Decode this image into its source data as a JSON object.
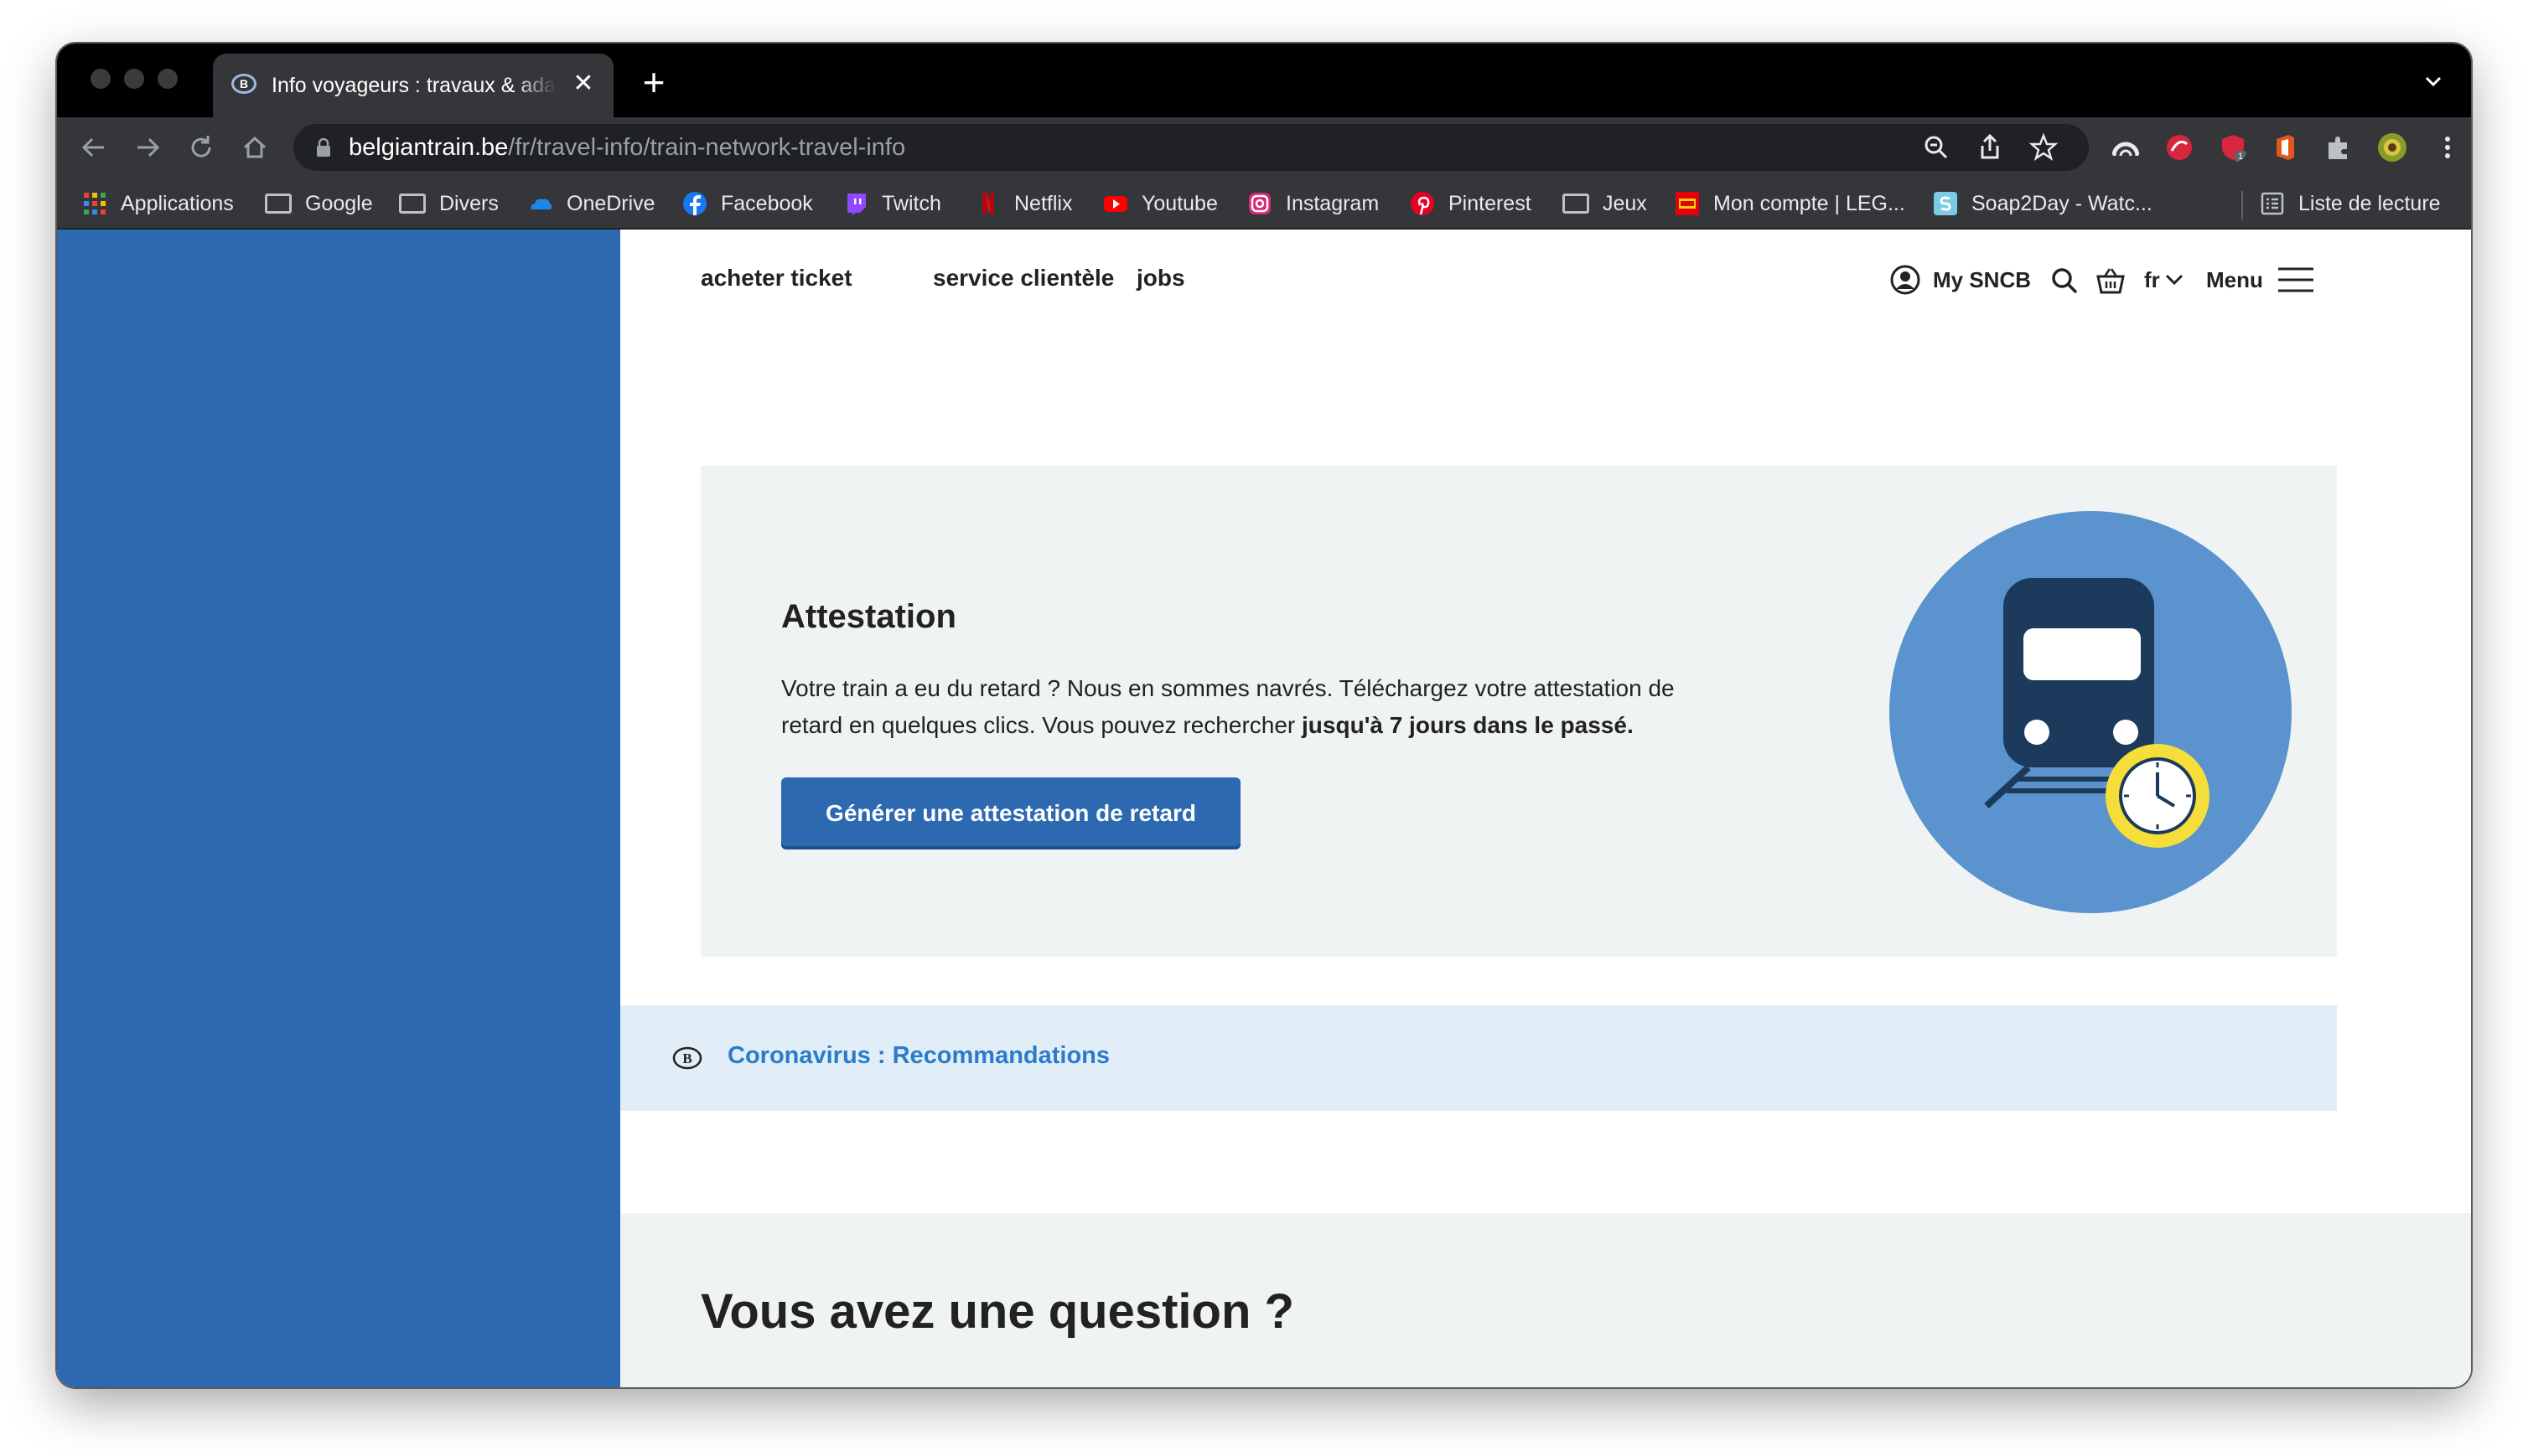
{
  "browser": {
    "tab_title": "Info voyageurs : travaux & adaptations",
    "tab_close": "✕",
    "new_tab": "+",
    "url_host": "belgiantrain.be",
    "url_path": "/fr/travel-info/train-network-travel-info",
    "extension_badge": "1"
  },
  "bookmarks": {
    "items": [
      {
        "label": "Applications",
        "icon": "apps-grid-icon"
      },
      {
        "label": "Google",
        "icon": "folder-icon"
      },
      {
        "label": "Divers",
        "icon": "folder-icon"
      },
      {
        "label": "OneDrive",
        "icon": "onedrive-icon"
      },
      {
        "label": "Facebook",
        "icon": "facebook-icon"
      },
      {
        "label": "Twitch",
        "icon": "twitch-icon"
      },
      {
        "label": "Netflix",
        "icon": "netflix-icon"
      },
      {
        "label": "Youtube",
        "icon": "youtube-icon"
      },
      {
        "label": "Instagram",
        "icon": "instagram-icon"
      },
      {
        "label": "Pinterest",
        "icon": "pinterest-icon"
      },
      {
        "label": "Jeux",
        "icon": "folder-icon"
      },
      {
        "label": "Mon compte | LEG...",
        "icon": "lego-icon"
      },
      {
        "label": "Soap2Day - Watc...",
        "icon": "soap2day-icon"
      }
    ],
    "reading_list": "Liste de lecture"
  },
  "site": {
    "nav": {
      "buy_ticket": "acheter ticket",
      "customer_service": "service clientèle",
      "jobs": "jobs",
      "my_sncb": "My SNCB",
      "language": "fr",
      "menu": "Menu"
    },
    "attestation": {
      "title": "Attestation",
      "text_line_1": "Votre train a eu du retard ? Nous en sommes navrés. Téléchargez votre attestation de",
      "text_line_2": "retard en quelques clics. Vous pouvez rechercher ",
      "text_bold": "jusqu'à 7 jours dans le passé.",
      "button": "Générer une attestation de retard"
    },
    "covid_link": "Coronavirus : Recommandations",
    "question_title": "Vous avez une question ?"
  },
  "colors": {
    "sncb_blue": "#2c69b0",
    "link_blue": "#2c7bcb",
    "illustration_circle": "#5a93cd",
    "train_dark": "#1b3a5c",
    "clock_yellow": "#f5dd3a",
    "card_bg": "#f0f3f4",
    "banner_bg": "#e1edf7"
  }
}
